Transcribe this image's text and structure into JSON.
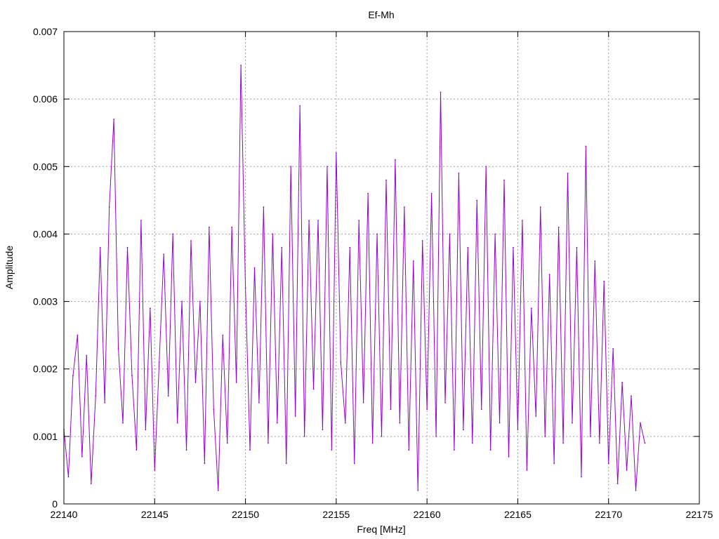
{
  "chart_data": {
    "type": "line",
    "title": "Ef-Mh",
    "xlabel": "Freq [MHz]",
    "ylabel": "Amplitude",
    "xlim": [
      22140,
      22175
    ],
    "ylim": [
      0,
      0.007
    ],
    "x_ticks": [
      22140,
      22145,
      22150,
      22155,
      22160,
      22165,
      22170,
      22175
    ],
    "y_ticks": [
      0,
      0.001,
      0.002,
      0.003,
      0.004,
      0.005,
      0.006,
      0.007
    ],
    "x_tick_labels": [
      "22140",
      "22145",
      "22150",
      "22155",
      "22160",
      "22165",
      "22170",
      "22175"
    ],
    "y_tick_labels": [
      "0",
      "0.001",
      "0.002",
      "0.003",
      "0.004",
      "0.005",
      "0.006",
      "0.007"
    ],
    "grid": true,
    "series": [
      {
        "color": "#9400d3",
        "x": [
          22140.0,
          22140.25,
          22140.5,
          22140.75,
          22141.0,
          22141.25,
          22141.5,
          22141.75,
          22142.0,
          22142.25,
          22142.5,
          22142.75,
          22143.0,
          22143.25,
          22143.5,
          22143.75,
          22144.0,
          22144.25,
          22144.5,
          22144.75,
          22145.0,
          22145.25,
          22145.5,
          22145.75,
          22146.0,
          22146.25,
          22146.5,
          22146.75,
          22147.0,
          22147.25,
          22147.5,
          22147.75,
          22148.0,
          22148.25,
          22148.5,
          22148.75,
          22149.0,
          22149.25,
          22149.5,
          22149.75,
          22150.0,
          22150.25,
          22150.5,
          22150.75,
          22151.0,
          22151.25,
          22151.5,
          22151.75,
          22152.0,
          22152.25,
          22152.5,
          22152.75,
          22153.0,
          22153.25,
          22153.5,
          22153.75,
          22154.0,
          22154.25,
          22154.5,
          22154.75,
          22155.0,
          22155.25,
          22155.5,
          22155.75,
          22156.0,
          22156.25,
          22156.5,
          22156.75,
          22157.0,
          22157.25,
          22157.5,
          22157.75,
          22158.0,
          22158.25,
          22158.5,
          22158.75,
          22159.0,
          22159.25,
          22159.5,
          22159.75,
          22160.0,
          22160.25,
          22160.5,
          22160.75,
          22161.0,
          22161.25,
          22161.5,
          22161.75,
          22162.0,
          22162.25,
          22162.5,
          22162.75,
          22163.0,
          22163.25,
          22163.5,
          22163.75,
          22164.0,
          22164.25,
          22164.5,
          22164.75,
          22165.0,
          22165.25,
          22165.5,
          22165.75,
          22166.0,
          22166.25,
          22166.5,
          22166.75,
          22167.0,
          22167.25,
          22167.5,
          22167.75,
          22168.0,
          22168.25,
          22168.5,
          22168.75,
          22169.0,
          22169.25,
          22169.5,
          22169.75,
          22170.0,
          22170.25,
          22170.5,
          22170.75,
          22171.0,
          22171.25,
          22171.5,
          22171.75,
          22172.0
        ],
        "y": [
          0.0011,
          0.0004,
          0.0019,
          0.0025,
          0.0007,
          0.0022,
          0.0003,
          0.0016,
          0.0038,
          0.0015,
          0.0044,
          0.0057,
          0.0023,
          0.0012,
          0.0038,
          0.0019,
          0.0008,
          0.0042,
          0.0011,
          0.0029,
          0.0005,
          0.0021,
          0.0037,
          0.0016,
          0.004,
          0.0012,
          0.003,
          0.0008,
          0.0039,
          0.0018,
          0.003,
          0.0006,
          0.0041,
          0.0014,
          0.0002,
          0.0025,
          0.0009,
          0.0041,
          0.0018,
          0.0065,
          0.0032,
          0.0008,
          0.0035,
          0.0015,
          0.0044,
          0.0009,
          0.004,
          0.0012,
          0.0038,
          0.0006,
          0.005,
          0.0013,
          0.0059,
          0.001,
          0.0042,
          0.0017,
          0.0042,
          0.0011,
          0.005,
          0.0008,
          0.0052,
          0.0021,
          0.0012,
          0.0038,
          0.0006,
          0.0042,
          0.0015,
          0.0046,
          0.0009,
          0.004,
          0.001,
          0.0048,
          0.0014,
          0.0051,
          0.0012,
          0.0044,
          0.0008,
          0.0036,
          0.0002,
          0.0039,
          0.0014,
          0.0046,
          0.001,
          0.0061,
          0.0015,
          0.004,
          0.0008,
          0.0049,
          0.0011,
          0.0038,
          0.0009,
          0.0045,
          0.0014,
          0.005,
          0.0008,
          0.004,
          0.0012,
          0.0048,
          0.0007,
          0.0038,
          0.0011,
          0.0042,
          0.0005,
          0.0029,
          0.0013,
          0.0044,
          0.001,
          0.0034,
          0.0006,
          0.0041,
          0.0009,
          0.0049,
          0.0012,
          0.0038,
          0.0004,
          0.0053,
          0.001,
          0.0036,
          0.0009,
          0.0033,
          0.0006,
          0.0023,
          0.0003,
          0.0018,
          0.0005,
          0.0016,
          0.0002,
          0.0012,
          0.0009
        ]
      }
    ]
  }
}
